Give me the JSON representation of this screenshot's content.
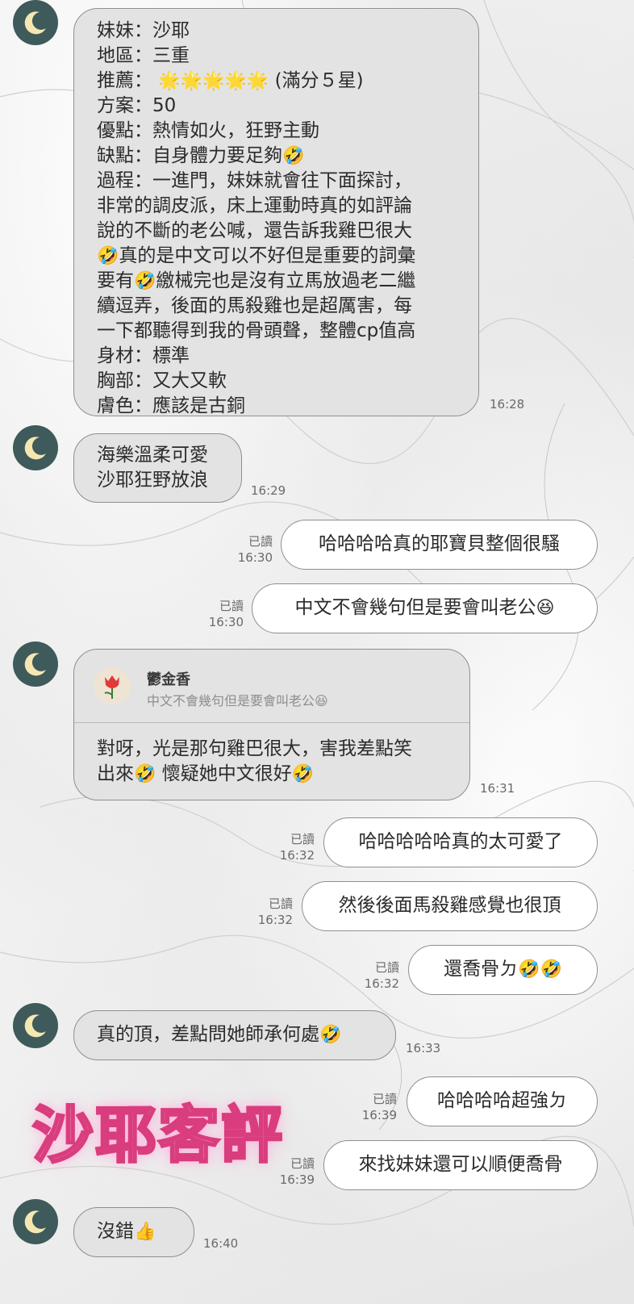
{
  "colors": {
    "avatar_bg": "#3e5a5b",
    "incoming_bubble": "#e3e3e3",
    "outgoing_bubble": "#ffffff",
    "watermark": "#f58fba"
  },
  "avatar_icon": "crescent-moon-icon",
  "messages": {
    "m1": {
      "lines": [
        "妹妹：沙耶",
        "地區：三重",
        "推薦：",
        "方案：50",
        "優點：熱情如火，狂野主動",
        "缺點：自身體力要足夠",
        "過程：一進門，妹妹就會往下面探討，",
        "非常的調皮派，床上運動時真的如評論",
        "說的不斷的老公喊，還告訴我雞巴很大",
        "真的是中文可以不好但是重要的詞彙",
        "要有",
        "繳械完也是沒有立馬放過老二繼",
        "續逗弄，後面的馬殺雞也是超厲害，每",
        "一下都聽得到我的骨頭聲，整體cp值高",
        "身材：標準",
        "胸部：又大又軟",
        "膚色：應該是古銅"
      ],
      "stars": "🌟🌟🌟🌟🌟",
      "stars_note": "(滿分５星)",
      "emoji_rofl": "🤣",
      "time": "16:28"
    },
    "m2": {
      "lines": [
        "海樂溫柔可愛",
        "沙耶狂野放浪"
      ],
      "time": "16:29"
    },
    "m3": {
      "text": "哈哈哈哈真的耶寶貝整個很騷",
      "read": "已讀",
      "time": "16:30"
    },
    "m4": {
      "text": "中文不會幾句但是要會叫老公",
      "emoji": "😆",
      "read": "已讀",
      "time": "16:30"
    },
    "m5": {
      "reply_name": "鬱金香",
      "reply_text": "中文不會幾句但是要會叫老公",
      "reply_emoji": "😆",
      "line1": "對呀，光是那句雞巴很大，害我差點笑",
      "line2a": "出來",
      "line2b": "懷疑她中文很好",
      "emoji": "🤣",
      "time": "16:31"
    },
    "m6": {
      "text": "哈哈哈哈哈真的太可愛了",
      "read": "已讀",
      "time": "16:32"
    },
    "m7": {
      "text": "然後後面馬殺雞感覺也很頂",
      "read": "已讀",
      "time": "16:32"
    },
    "m8": {
      "text": "還喬骨ㄉ",
      "emoji": "🤣🤣",
      "read": "已讀",
      "time": "16:32"
    },
    "m9": {
      "text": "真的頂，差點問她師承何處",
      "emoji": "🤣",
      "time": "16:33"
    },
    "m10": {
      "text": "哈哈哈哈超強ㄉ",
      "read": "已讀",
      "time": "16:39"
    },
    "m11": {
      "text": "來找妹妹還可以順便喬骨",
      "read": "已讀",
      "time": "16:39"
    },
    "m12": {
      "text": "沒錯",
      "emoji": "👍",
      "time": "16:40"
    }
  },
  "watermark": "沙耶客評"
}
